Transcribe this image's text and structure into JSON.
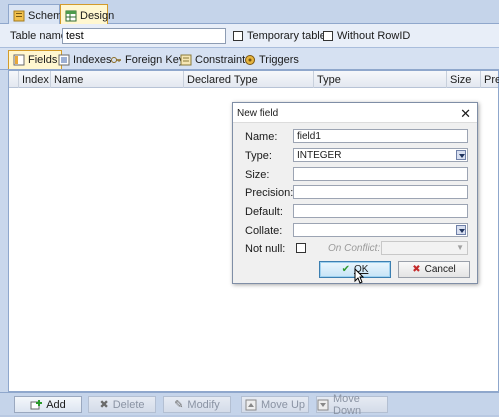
{
  "top_tabs": [
    {
      "label": "Schema",
      "icon": "schema-icon"
    },
    {
      "label": "Design",
      "icon": "table-design-icon",
      "active": true
    }
  ],
  "namebar": {
    "table_name_label": "Table name:",
    "table_name_value": "test",
    "temporary_label": "Temporary table",
    "without_rowid_label": "Without RowID"
  },
  "section_tabs": [
    {
      "label": "Fields",
      "icon": "fields-icon",
      "active": true
    },
    {
      "label": "Indexes",
      "icon": "indexes-icon"
    },
    {
      "label": "Foreign Keys",
      "icon": "foreign-keys-icon"
    },
    {
      "label": "Constraints",
      "icon": "constraints-icon"
    },
    {
      "label": "Triggers",
      "icon": "triggers-icon"
    }
  ],
  "grid": {
    "columns": [
      "Index",
      "Name",
      "Declared Type",
      "Type",
      "Size",
      "Preci"
    ]
  },
  "bottom_toolbar": {
    "add": "Add",
    "delete": "Delete",
    "modify": "Modify",
    "move_up": "Move Up",
    "move_down": "Move Down"
  },
  "dialog": {
    "title": "New field",
    "name_label": "Name:",
    "name_value": "field1",
    "type_label": "Type:",
    "type_value": "INTEGER",
    "size_label": "Size:",
    "precision_label": "Precision:",
    "default_label": "Default:",
    "collate_label": "Collate:",
    "not_null_label": "Not null:",
    "on_conflict_label": "On Conflict:",
    "ok_label": "OK",
    "cancel_label": "Cancel"
  },
  "colors": {
    "accent_active_tab": "#fff7d0",
    "active_tab_border": "#d39b2a",
    "app_background": "#c9d7ec"
  }
}
